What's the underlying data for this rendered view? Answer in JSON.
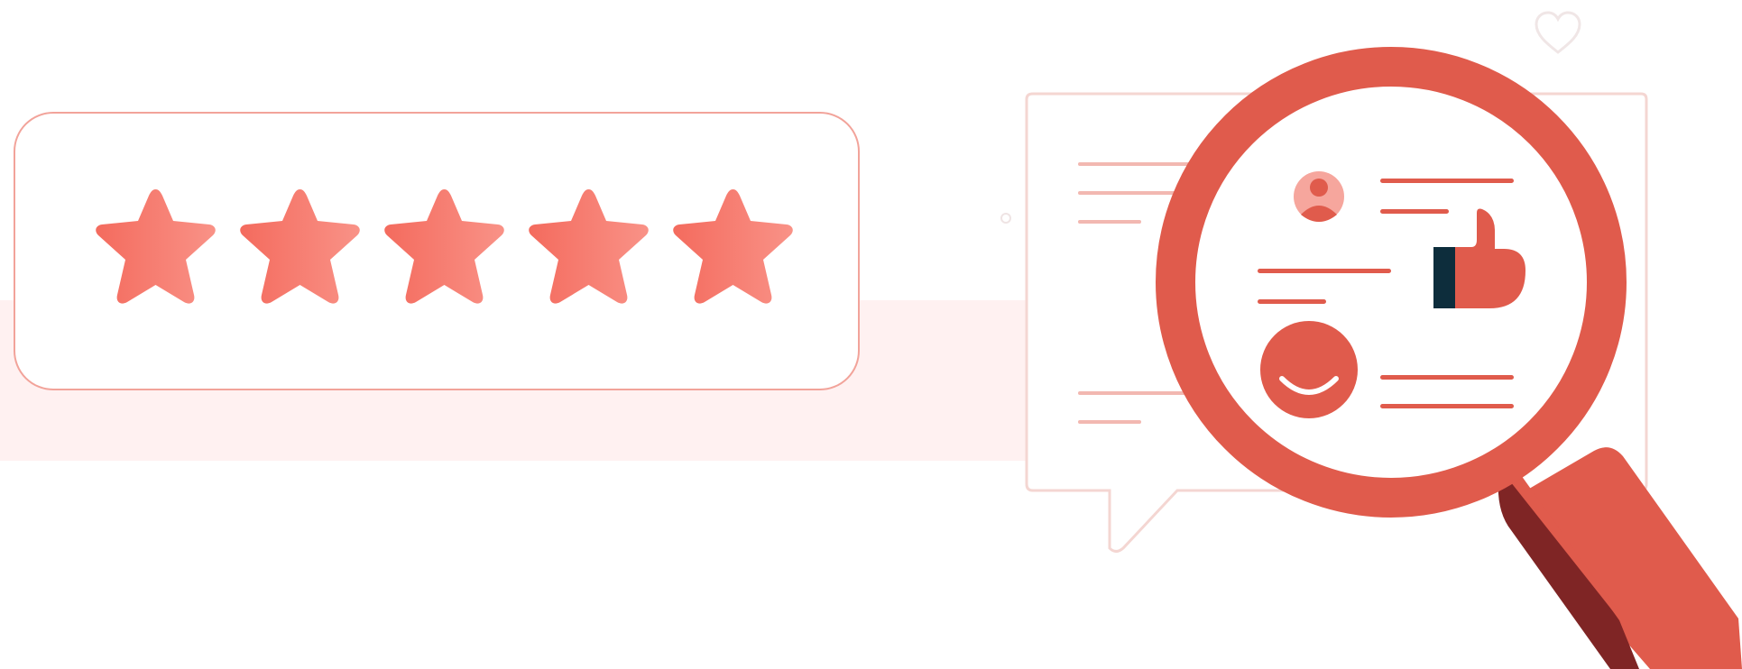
{
  "rating": {
    "value": 5,
    "max": 5,
    "star_color": "#f47a6d"
  },
  "colors": {
    "background": "#ffffff",
    "band": "#fff1f1",
    "card_border": "#f2a39a",
    "accent": "#e05b4c",
    "accent_light": "#f6a69d",
    "handle_dark": "#7f2525",
    "navy": "#0d2d3c"
  },
  "icons": {
    "heart": "heart-outline-icon",
    "magnifier": "magnifying-glass-icon",
    "thumbs_up": "thumbs-up-icon",
    "avatar": "user-avatar-icon",
    "smiley": "smiley-icon"
  }
}
